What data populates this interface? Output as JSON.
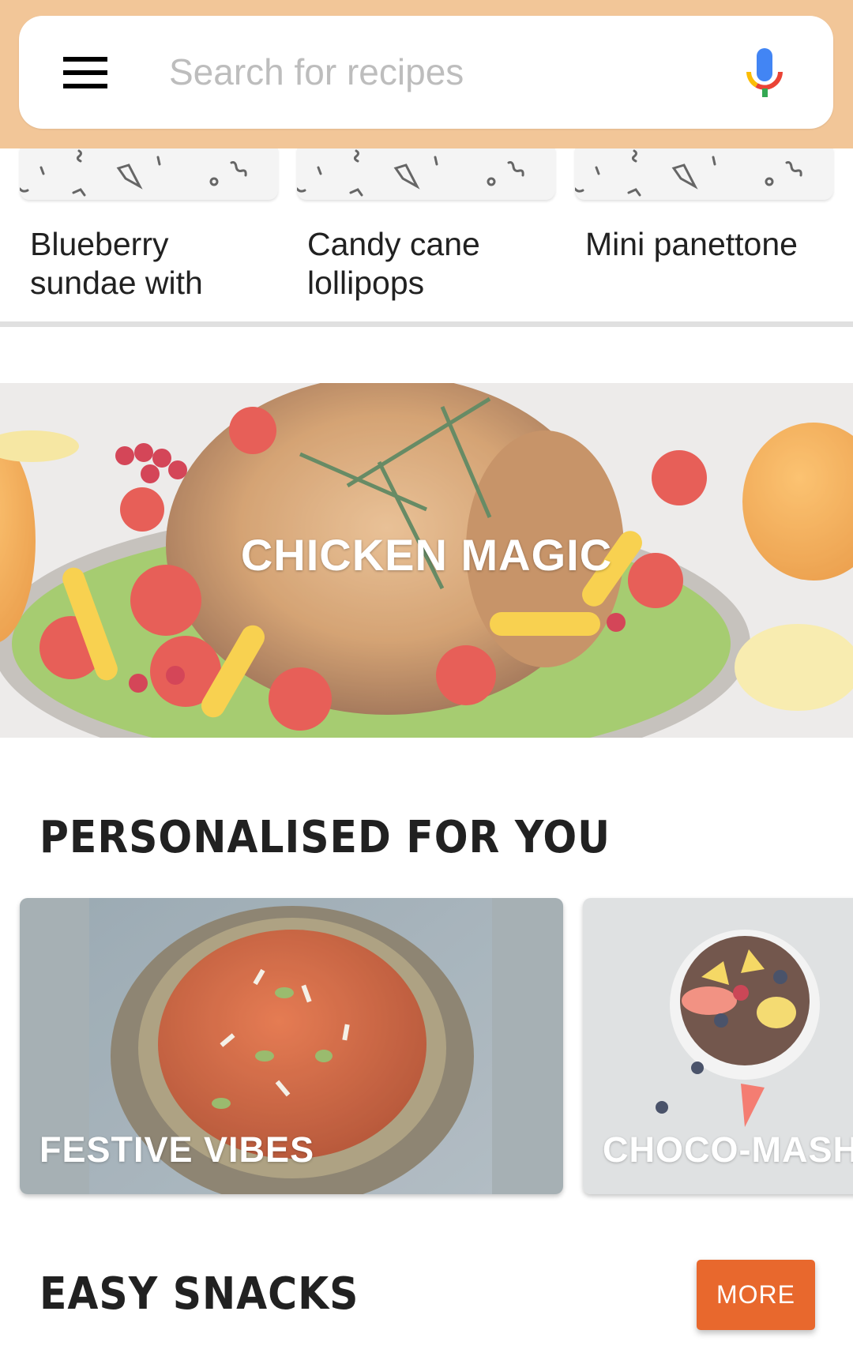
{
  "header": {
    "background_color": "#F2C698",
    "menu_icon": "hamburger-menu-icon",
    "search_placeholder": "Search for recipes",
    "search_value": "",
    "mic_icon": "microphone-icon"
  },
  "recipes": [
    {
      "title": "Blueberry sundae with"
    },
    {
      "title": "Candy cane lollipops"
    },
    {
      "title": "Mini panettone"
    }
  ],
  "hero": {
    "title": "CHICKEN MAGIC"
  },
  "personalised": {
    "title": "PERSONALISED FOR YOU",
    "cards": [
      {
        "title": "FESTIVE VIBES"
      },
      {
        "title": "CHOCO-MASH"
      }
    ]
  },
  "easy_snacks": {
    "title": "EASY SNACKS",
    "more_label": "MORE",
    "accent_color": "#E8682D"
  }
}
